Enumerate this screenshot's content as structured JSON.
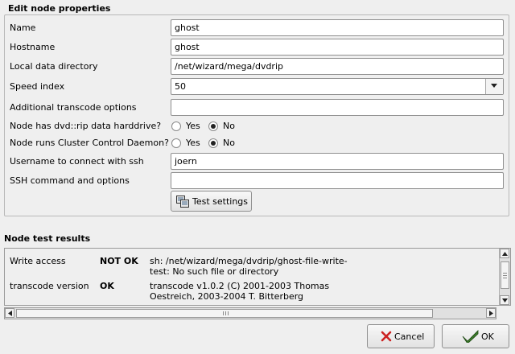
{
  "edit_section": {
    "title": "Edit node properties",
    "fields": {
      "name": {
        "label": "Name",
        "value": "ghost"
      },
      "hostname": {
        "label": "Hostname",
        "value": "ghost"
      },
      "data_dir": {
        "label": "Local data directory",
        "value": "/net/wizard/mega/dvdrip"
      },
      "speed": {
        "label": "Speed index",
        "value": "50"
      },
      "transcode_opts": {
        "label": "Additional transcode options",
        "value": ""
      },
      "harddrive": {
        "label": "Node has dvd::rip data harddrive?",
        "yes": "Yes",
        "no": "No",
        "selected": "No"
      },
      "ccd": {
        "label": "Node runs Cluster Control Daemon?",
        "yes": "Yes",
        "no": "No",
        "selected": "No"
      },
      "ssh_user": {
        "label": "Username to connect with ssh",
        "value": "joern"
      },
      "ssh_cmd": {
        "label": "SSH command and options",
        "value": ""
      }
    },
    "test_button": "Test settings"
  },
  "results_section": {
    "title": "Node test results",
    "rows": [
      {
        "name": "Write access",
        "status": "NOT OK",
        "detail_1": "sh: /net/wizard/mega/dvdrip/ghost-file-write-",
        "detail_2": "test: No such file or directory"
      },
      {
        "name": "transcode version",
        "status": "OK",
        "detail_1": "transcode v1.0.2 (C) 2001-2003 Thomas",
        "detail_2": "Oestreich, 2003-2004 T. Bitterberg"
      }
    ]
  },
  "footer": {
    "cancel": "Cancel",
    "ok": "OK"
  },
  "colors": {
    "background": "#efefef",
    "cancel_icon": "#cc2222",
    "ok_icon": "#3a7a2a"
  }
}
